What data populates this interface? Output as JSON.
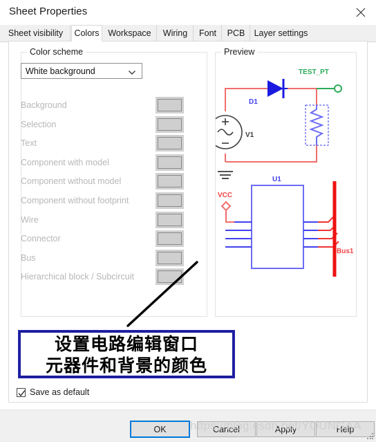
{
  "window": {
    "title": "Sheet Properties",
    "close_icon": "close-icon"
  },
  "tabs": [
    {
      "label": "Sheet visibility",
      "active": false
    },
    {
      "label": "Colors",
      "active": true
    },
    {
      "label": "Workspace",
      "active": false
    },
    {
      "label": "Wiring",
      "active": false
    },
    {
      "label": "Font",
      "active": false
    },
    {
      "label": "PCB",
      "active": false
    },
    {
      "label": "Layer settings",
      "active": false
    }
  ],
  "color_scheme": {
    "group_title": "Color scheme",
    "selected_scheme": "White background",
    "dropdown_icon": "chevron-down-icon",
    "items": [
      {
        "label": "Background",
        "swatch": "#cfcfcf"
      },
      {
        "label": "Selection",
        "swatch": "#cfcfcf"
      },
      {
        "label": "Text",
        "swatch": "#cfcfcf"
      },
      {
        "label": "Component with model",
        "swatch": "#cfcfcf"
      },
      {
        "label": "Component without model",
        "swatch": "#cfcfcf"
      },
      {
        "label": "Component without footprint",
        "swatch": "#cfcfcf"
      },
      {
        "label": "Wire",
        "swatch": "#cfcfcf"
      },
      {
        "label": "Connector",
        "swatch": "#cfcfcf"
      },
      {
        "label": "Bus",
        "swatch": "#cfcfcf"
      },
      {
        "label": "Hierarchical block / Subcircuit",
        "swatch": "#cfcfcf"
      }
    ]
  },
  "preview": {
    "group_title": "Preview",
    "labels": {
      "diode": "D1",
      "source": "V1",
      "test_point": "TEST_PT",
      "ic": "U1",
      "power": "VCC",
      "bus": "Bus1"
    },
    "colors": {
      "wire": "#f26d6d",
      "component": "#6b6bf5",
      "bus": "#ee1111",
      "text_green": "#2bab5a",
      "connector": "#2bab5a",
      "diode_fill": "#1a1ae0",
      "source_outline": "#3a3a3a"
    }
  },
  "annotation": {
    "line1": "设置电路编辑窗口",
    "line2": "元器件和背景的颜色",
    "border_color": "#1d1d9e"
  },
  "options": {
    "save_as_default_label": "Save as default",
    "save_as_default_checked": true,
    "check_icon": "check-icon"
  },
  "footer": {
    "ok": "OK",
    "cancel": "Cancel",
    "apply": "Apply",
    "help": "Help",
    "accent": "#0078d7"
  },
  "watermark": {
    "text": "https://blog.csdn.net/YOUNGAA"
  }
}
